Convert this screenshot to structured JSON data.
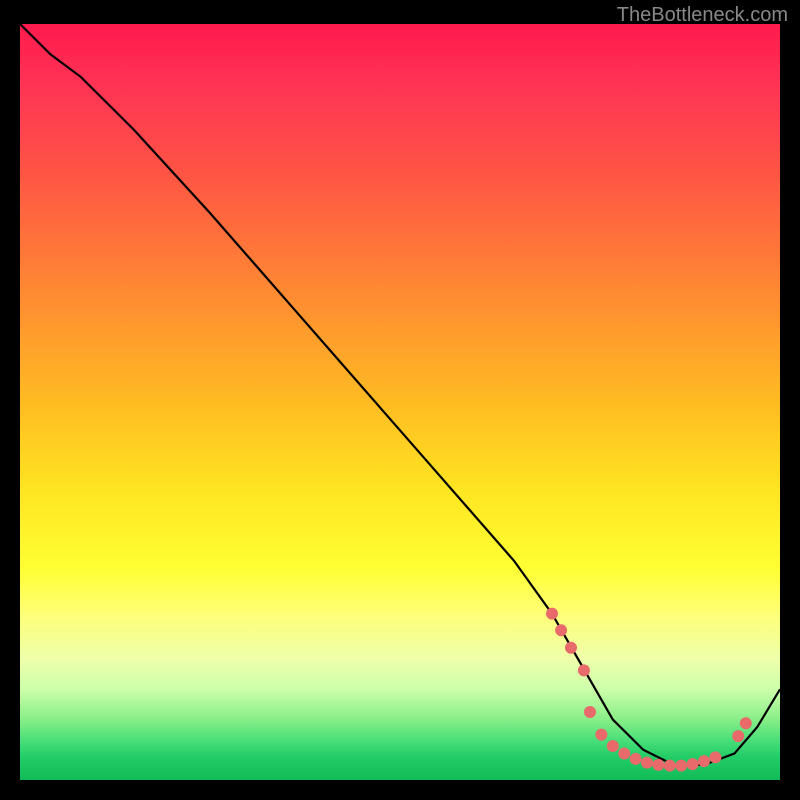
{
  "watermark": "TheBottleneck.com",
  "chart_data": {
    "type": "line",
    "title": "",
    "xlabel": "",
    "ylabel": "",
    "xlim": [
      0,
      100
    ],
    "ylim": [
      0,
      100
    ],
    "series": [
      {
        "name": "curve",
        "x": [
          0,
          4,
          8,
          15,
          25,
          35,
          45,
          55,
          65,
          70,
          74,
          78,
          82,
          86,
          90,
          94,
          97,
          100
        ],
        "y": [
          100,
          96,
          93,
          86,
          75,
          63.5,
          52,
          40.5,
          29,
          22,
          15,
          8,
          4,
          2,
          2,
          3.5,
          7,
          12
        ]
      }
    ],
    "markers": [
      {
        "x": 70.0,
        "y": 22.0
      },
      {
        "x": 71.2,
        "y": 19.8
      },
      {
        "x": 72.5,
        "y": 17.5
      },
      {
        "x": 74.2,
        "y": 14.5
      },
      {
        "x": 75.0,
        "y": 9.0
      },
      {
        "x": 76.5,
        "y": 6.0
      },
      {
        "x": 78.0,
        "y": 4.5
      },
      {
        "x": 79.5,
        "y": 3.5
      },
      {
        "x": 81.0,
        "y": 2.8
      },
      {
        "x": 82.5,
        "y": 2.3
      },
      {
        "x": 84.0,
        "y": 2.0
      },
      {
        "x": 85.5,
        "y": 1.9
      },
      {
        "x": 87.0,
        "y": 1.9
      },
      {
        "x": 88.5,
        "y": 2.1
      },
      {
        "x": 90.0,
        "y": 2.5
      },
      {
        "x": 91.5,
        "y": 3.0
      },
      {
        "x": 94.5,
        "y": 5.8
      },
      {
        "x": 95.5,
        "y": 7.5
      }
    ],
    "colors": {
      "curve": "#000000",
      "marker": "#e86a6a",
      "gradient_top": "#ff1a4d",
      "gradient_mid": "#ffe622",
      "gradient_bottom": "#11bb55"
    }
  }
}
